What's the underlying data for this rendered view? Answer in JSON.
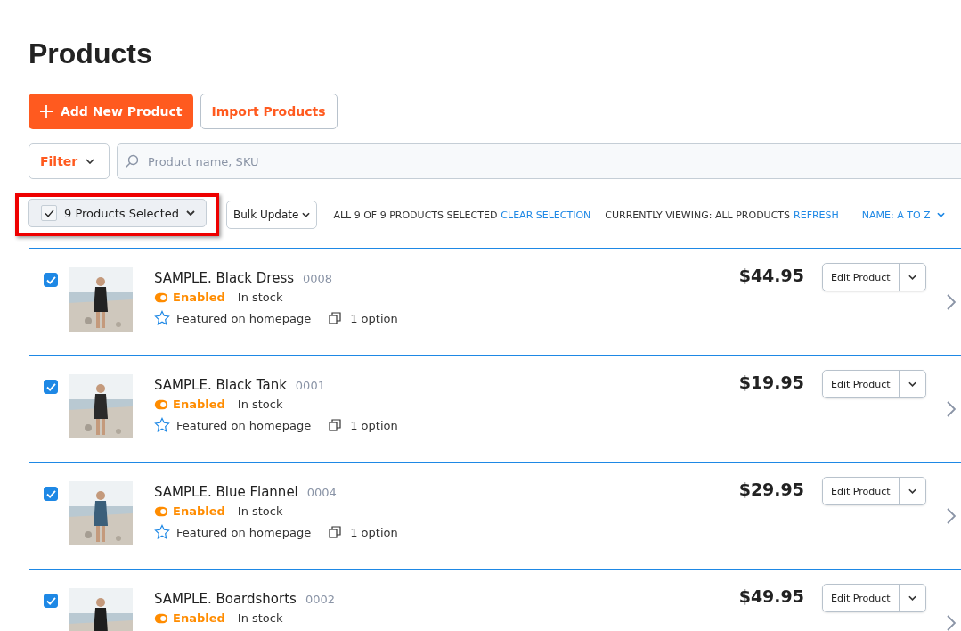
{
  "title": "Products",
  "actions": [
    {
      "label": "Add New Product",
      "kind": "primary"
    },
    {
      "label": "Import Products",
      "kind": "secondary"
    }
  ],
  "filter": {
    "label": "Filter"
  },
  "search": {
    "placeholder": "Product name, SKU"
  },
  "selection": {
    "label": "9 Products Selected",
    "checked": true,
    "bulk": "Bulk Update",
    "summary": "ALL 9 OF 9 PRODUCTS SELECTED",
    "clear": "CLEAR SELECTION",
    "viewing": "CURRENTLY VIEWING: ALL PRODUCTS",
    "refresh": "REFRESH",
    "sort": "NAME: A TO Z"
  },
  "products": [
    {
      "selected": true,
      "name": "SAMPLE. Black Dress",
      "sku": "0008",
      "enabled": true,
      "status": "Enabled",
      "stock": "In stock",
      "featured": "Featured on homepage",
      "options": "1 option",
      "price": "$44.95",
      "edit": "Edit Product"
    },
    {
      "selected": true,
      "name": "SAMPLE. Black Tank",
      "sku": "0001",
      "enabled": true,
      "status": "Enabled",
      "stock": "In stock",
      "featured": "Featured on homepage",
      "options": "1 option",
      "price": "$19.95",
      "edit": "Edit Product"
    },
    {
      "selected": true,
      "name": "SAMPLE. Blue Flannel",
      "sku": "0004",
      "enabled": true,
      "status": "Enabled",
      "stock": "In stock",
      "featured": "Featured on homepage",
      "options": "1 option",
      "price": "$29.95",
      "edit": "Edit Product"
    },
    {
      "selected": true,
      "name": "SAMPLE. Boardshorts",
      "sku": "0002",
      "enabled": true,
      "status": "Enabled",
      "stock": "In stock",
      "price": "$49.95",
      "edit": "Edit Product"
    }
  ]
}
